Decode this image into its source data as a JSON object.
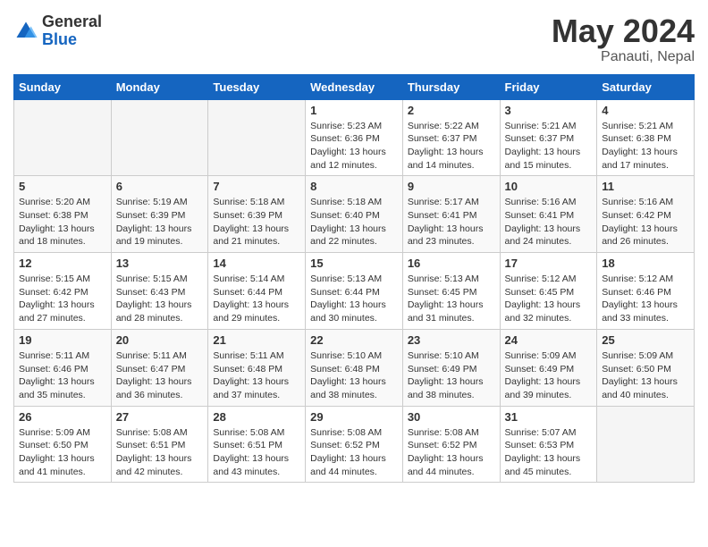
{
  "header": {
    "logo_general": "General",
    "logo_blue": "Blue",
    "month_title": "May 2024",
    "location": "Panauti, Nepal"
  },
  "days_of_week": [
    "Sunday",
    "Monday",
    "Tuesday",
    "Wednesday",
    "Thursday",
    "Friday",
    "Saturday"
  ],
  "weeks": [
    [
      {
        "day": "",
        "info": ""
      },
      {
        "day": "",
        "info": ""
      },
      {
        "day": "",
        "info": ""
      },
      {
        "day": "1",
        "info": "Sunrise: 5:23 AM\nSunset: 6:36 PM\nDaylight: 13 hours and 12 minutes."
      },
      {
        "day": "2",
        "info": "Sunrise: 5:22 AM\nSunset: 6:37 PM\nDaylight: 13 hours and 14 minutes."
      },
      {
        "day": "3",
        "info": "Sunrise: 5:21 AM\nSunset: 6:37 PM\nDaylight: 13 hours and 15 minutes."
      },
      {
        "day": "4",
        "info": "Sunrise: 5:21 AM\nSunset: 6:38 PM\nDaylight: 13 hours and 17 minutes."
      }
    ],
    [
      {
        "day": "5",
        "info": "Sunrise: 5:20 AM\nSunset: 6:38 PM\nDaylight: 13 hours and 18 minutes."
      },
      {
        "day": "6",
        "info": "Sunrise: 5:19 AM\nSunset: 6:39 PM\nDaylight: 13 hours and 19 minutes."
      },
      {
        "day": "7",
        "info": "Sunrise: 5:18 AM\nSunset: 6:39 PM\nDaylight: 13 hours and 21 minutes."
      },
      {
        "day": "8",
        "info": "Sunrise: 5:18 AM\nSunset: 6:40 PM\nDaylight: 13 hours and 22 minutes."
      },
      {
        "day": "9",
        "info": "Sunrise: 5:17 AM\nSunset: 6:41 PM\nDaylight: 13 hours and 23 minutes."
      },
      {
        "day": "10",
        "info": "Sunrise: 5:16 AM\nSunset: 6:41 PM\nDaylight: 13 hours and 24 minutes."
      },
      {
        "day": "11",
        "info": "Sunrise: 5:16 AM\nSunset: 6:42 PM\nDaylight: 13 hours and 26 minutes."
      }
    ],
    [
      {
        "day": "12",
        "info": "Sunrise: 5:15 AM\nSunset: 6:42 PM\nDaylight: 13 hours and 27 minutes."
      },
      {
        "day": "13",
        "info": "Sunrise: 5:15 AM\nSunset: 6:43 PM\nDaylight: 13 hours and 28 minutes."
      },
      {
        "day": "14",
        "info": "Sunrise: 5:14 AM\nSunset: 6:44 PM\nDaylight: 13 hours and 29 minutes."
      },
      {
        "day": "15",
        "info": "Sunrise: 5:13 AM\nSunset: 6:44 PM\nDaylight: 13 hours and 30 minutes."
      },
      {
        "day": "16",
        "info": "Sunrise: 5:13 AM\nSunset: 6:45 PM\nDaylight: 13 hours and 31 minutes."
      },
      {
        "day": "17",
        "info": "Sunrise: 5:12 AM\nSunset: 6:45 PM\nDaylight: 13 hours and 32 minutes."
      },
      {
        "day": "18",
        "info": "Sunrise: 5:12 AM\nSunset: 6:46 PM\nDaylight: 13 hours and 33 minutes."
      }
    ],
    [
      {
        "day": "19",
        "info": "Sunrise: 5:11 AM\nSunset: 6:46 PM\nDaylight: 13 hours and 35 minutes."
      },
      {
        "day": "20",
        "info": "Sunrise: 5:11 AM\nSunset: 6:47 PM\nDaylight: 13 hours and 36 minutes."
      },
      {
        "day": "21",
        "info": "Sunrise: 5:11 AM\nSunset: 6:48 PM\nDaylight: 13 hours and 37 minutes."
      },
      {
        "day": "22",
        "info": "Sunrise: 5:10 AM\nSunset: 6:48 PM\nDaylight: 13 hours and 38 minutes."
      },
      {
        "day": "23",
        "info": "Sunrise: 5:10 AM\nSunset: 6:49 PM\nDaylight: 13 hours and 38 minutes."
      },
      {
        "day": "24",
        "info": "Sunrise: 5:09 AM\nSunset: 6:49 PM\nDaylight: 13 hours and 39 minutes."
      },
      {
        "day": "25",
        "info": "Sunrise: 5:09 AM\nSunset: 6:50 PM\nDaylight: 13 hours and 40 minutes."
      }
    ],
    [
      {
        "day": "26",
        "info": "Sunrise: 5:09 AM\nSunset: 6:50 PM\nDaylight: 13 hours and 41 minutes."
      },
      {
        "day": "27",
        "info": "Sunrise: 5:08 AM\nSunset: 6:51 PM\nDaylight: 13 hours and 42 minutes."
      },
      {
        "day": "28",
        "info": "Sunrise: 5:08 AM\nSunset: 6:51 PM\nDaylight: 13 hours and 43 minutes."
      },
      {
        "day": "29",
        "info": "Sunrise: 5:08 AM\nSunset: 6:52 PM\nDaylight: 13 hours and 44 minutes."
      },
      {
        "day": "30",
        "info": "Sunrise: 5:08 AM\nSunset: 6:52 PM\nDaylight: 13 hours and 44 minutes."
      },
      {
        "day": "31",
        "info": "Sunrise: 5:07 AM\nSunset: 6:53 PM\nDaylight: 13 hours and 45 minutes."
      },
      {
        "day": "",
        "info": ""
      }
    ]
  ]
}
